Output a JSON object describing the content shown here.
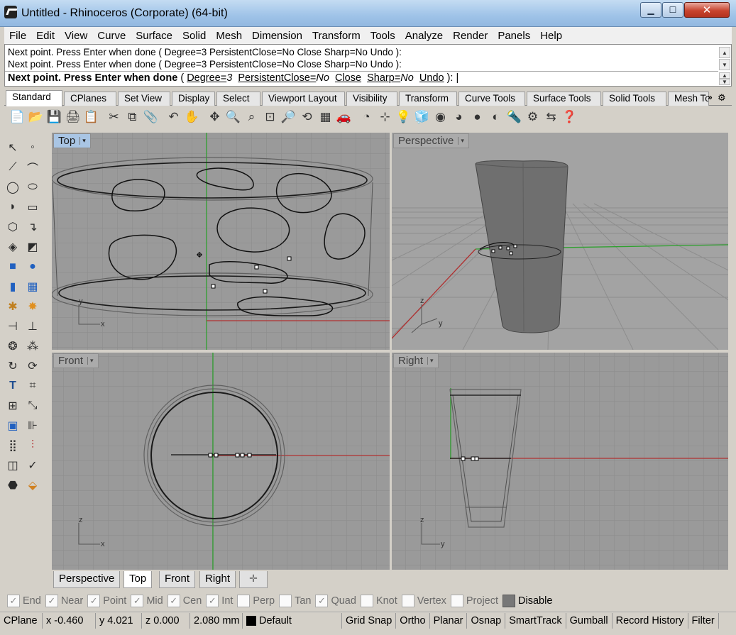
{
  "window": {
    "title": "Untitled - Rhinoceros (Corporate) (64-bit)",
    "min": "▁",
    "max": "☐",
    "close": "✕"
  },
  "menu": [
    "File",
    "Edit",
    "View",
    "Curve",
    "Surface",
    "Solid",
    "Mesh",
    "Dimension",
    "Transform",
    "Tools",
    "Analyze",
    "Render",
    "Panels",
    "Help"
  ],
  "command": {
    "history_1": "Next point. Press Enter when done ( Degree=3  PersistentClose=No  Close  Sharp=No  Undo ):",
    "history_2": "Next point. Press Enter when done ( Degree=3  PersistentClose=No  Close  Sharp=No  Undo ):",
    "prompt_bold": "Next point. Press Enter when done",
    "prompt_open": " ( ",
    "opt_degree": "Degree=",
    "opt_degree_val": "3",
    "opt_pclose": "PersistentClose=",
    "opt_pclose_val": "No",
    "opt_close": "Close",
    "opt_sharp": "Sharp=",
    "opt_sharp_val": "No",
    "opt_undo": "Undo",
    "prompt_end": " ): |"
  },
  "toolbar_tabs": [
    "Standard",
    "CPlanes",
    "Set View",
    "Display",
    "Select",
    "Viewport Layout",
    "Visibility",
    "Transform",
    "Curve Tools",
    "Surface Tools",
    "Solid Tools",
    "Mesh To"
  ],
  "toolbar_more": "»",
  "toolbar_icons": [
    "📄",
    "📂",
    "💾",
    "🖨",
    "📋",
    "✂",
    "⧉",
    "📎",
    "↶",
    "✋",
    "✥",
    "🔍",
    "⌕",
    "⊡",
    "🔎",
    "⟲",
    "▦",
    "🚗",
    "◔",
    "⊹",
    "💡",
    "🧊",
    "◉",
    "◕",
    "●",
    "◐",
    "🔦",
    "⚙",
    "⇆",
    "❓"
  ],
  "viewports": {
    "top": "Top",
    "perspective": "Perspective",
    "front": "Front",
    "right": "Right",
    "arrow": "▾"
  },
  "axes": {
    "top": [
      "y",
      "x"
    ],
    "persp": [
      "z",
      "y"
    ],
    "front": [
      "z",
      "x"
    ],
    "right": [
      "z",
      "y"
    ]
  },
  "viewport_tabs": [
    "Perspective",
    "Top",
    "Front",
    "Right"
  ],
  "viewport_tab_add": "✛",
  "osnaps": [
    {
      "label": "End",
      "checked": true
    },
    {
      "label": "Near",
      "checked": true
    },
    {
      "label": "Point",
      "checked": true
    },
    {
      "label": "Mid",
      "checked": true
    },
    {
      "label": "Cen",
      "checked": true
    },
    {
      "label": "Int",
      "checked": true
    },
    {
      "label": "Perp",
      "checked": false
    },
    {
      "label": "Tan",
      "checked": false
    },
    {
      "label": "Quad",
      "checked": true
    },
    {
      "label": "Knot",
      "checked": false
    },
    {
      "label": "Vertex",
      "checked": false
    },
    {
      "label": "Project",
      "checked": false
    },
    {
      "label": "Disable",
      "checked": false
    }
  ],
  "status": {
    "cplane": "CPlane",
    "x": "x -0.460",
    "y": "y 4.021",
    "z": "z 0.000",
    "units": "2.080 mm",
    "layer": "Default",
    "grid_snap": "Grid Snap",
    "ortho": "Ortho",
    "planar": "Planar",
    "osnap": "Osnap",
    "smarttrack": "SmartTrack",
    "gumball": "Gumball",
    "record_history": "Record History",
    "filter": "Filter"
  },
  "colors": {
    "viewport_bg": "#9a9a9a",
    "grid": "#8b8b8b",
    "x_axis": "#b03030",
    "y_axis": "#30a030",
    "active_label": "#a9c5e4"
  }
}
